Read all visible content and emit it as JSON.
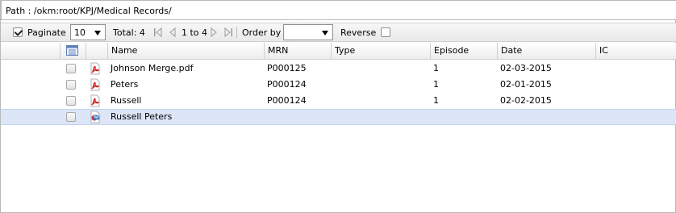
{
  "path": {
    "text": "Path : /okm:root/KPJ/Medical Records/"
  },
  "toolbar": {
    "paginate_label": "Paginate",
    "paginate_checked": true,
    "page_size": "10",
    "total_label": "Total: 4",
    "range_label": "1 to 4",
    "order_by_label": "Order by",
    "order_by_value": "",
    "reverse_label": "Reverse",
    "reverse_checked": false
  },
  "table": {
    "columns": [
      "Name",
      "MRN",
      "Type",
      "Episode",
      "Date",
      "IC"
    ],
    "rows": [
      {
        "icon": "pdf-icon",
        "name": "Johnson Merge.pdf",
        "mrn": "P000125",
        "type": "",
        "episode": "1",
        "date": "02-03-2015",
        "ic": ""
      },
      {
        "icon": "pdf-icon",
        "name": "Peters",
        "mrn": "P000124",
        "type": "",
        "episode": "1",
        "date": "02-01-2015",
        "ic": ""
      },
      {
        "icon": "pdf-icon",
        "name": "Russell",
        "mrn": "P000124",
        "type": "",
        "episode": "1",
        "date": "02-02-2015",
        "ic": ""
      },
      {
        "icon": "mail-icon",
        "name": "Russell Peters",
        "mrn": "",
        "type": "",
        "episode": "",
        "date": "",
        "ic": "",
        "selected": true
      }
    ]
  }
}
